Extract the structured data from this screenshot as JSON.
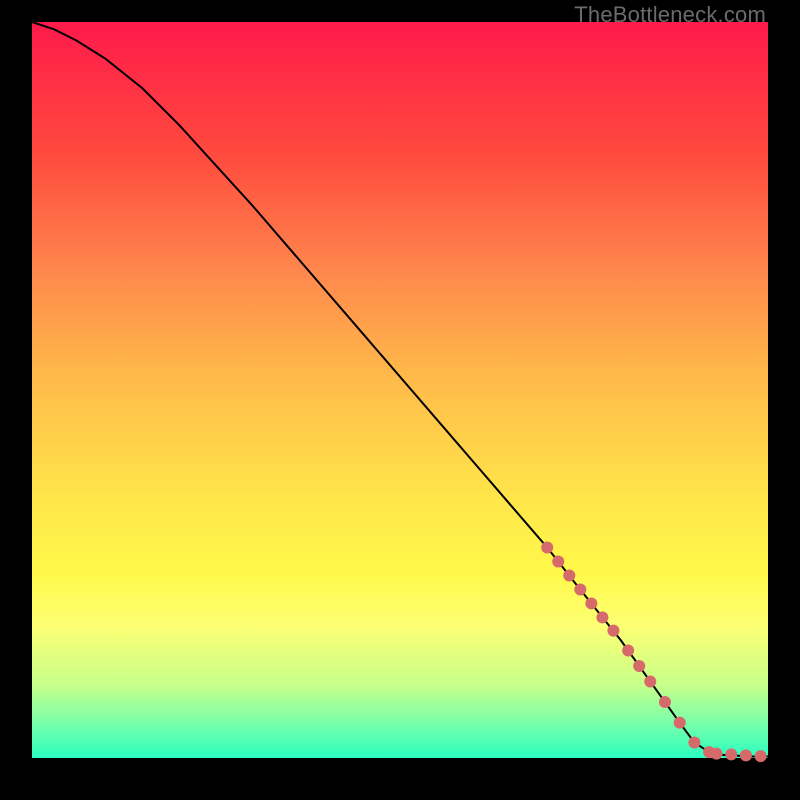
{
  "watermark": "TheBottleneck.com",
  "chart_data": {
    "type": "line",
    "title": "",
    "xlabel": "",
    "ylabel": "",
    "xlim": [
      0,
      100
    ],
    "ylim": [
      0,
      100
    ],
    "curve": {
      "name": "curve",
      "x": [
        0,
        3,
        6,
        10,
        15,
        20,
        25,
        30,
        35,
        40,
        45,
        50,
        55,
        60,
        65,
        70,
        74,
        78,
        80,
        82,
        84,
        86,
        88,
        90,
        92,
        94,
        96,
        98,
        100
      ],
      "y": [
        100,
        99,
        97.5,
        95,
        91,
        86,
        80.5,
        75,
        69.2,
        63.4,
        57.6,
        51.8,
        46,
        40.2,
        34.4,
        28.6,
        23.5,
        18.5,
        16,
        13.2,
        10.4,
        7.6,
        4.8,
        2.1,
        0.8,
        0.4,
        0.3,
        0.2,
        0.2
      ]
    },
    "markers": {
      "name": "points",
      "color": "#d66a6a",
      "radius_px": 6,
      "x": [
        70,
        71.5,
        73,
        74.5,
        76,
        77.5,
        79,
        81,
        82.5,
        84,
        86,
        88,
        90,
        92,
        93,
        95,
        97,
        99
      ],
      "y": [
        28.6,
        26.7,
        24.8,
        22.9,
        21,
        19.1,
        17.3,
        14.6,
        12.5,
        10.4,
        7.6,
        4.8,
        2.1,
        0.8,
        0.6,
        0.5,
        0.35,
        0.25
      ]
    }
  }
}
